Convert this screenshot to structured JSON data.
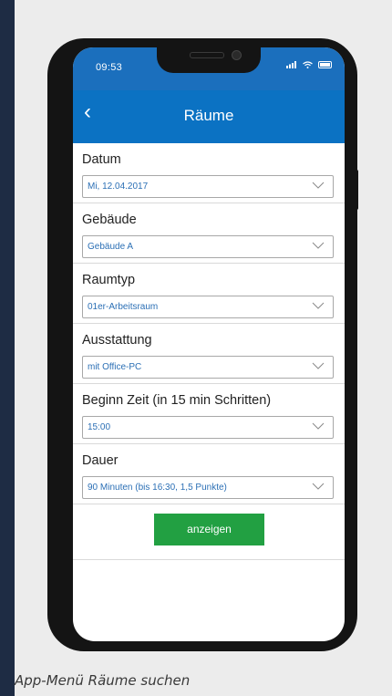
{
  "status_bar": {
    "time": "09:53",
    "signal_icon": "signal-bars-icon",
    "wifi_icon": "wifi-icon",
    "battery_icon": "battery-icon"
  },
  "nav": {
    "back_icon": "chevron-left-icon",
    "back_glyph": "‹",
    "title": "Räume",
    "color": "#0b72c3"
  },
  "form": {
    "fields": [
      {
        "label": "Datum",
        "value": "Mi, 12.04.2017"
      },
      {
        "label": "Gebäude",
        "value": "Gebäude A"
      },
      {
        "label": "Raumtyp",
        "value": "01er-Arbeitsraum"
      },
      {
        "label": "Ausstattung",
        "value": "mit Office-PC"
      },
      {
        "label": "Beginn Zeit (in 15 min Schritten)",
        "value": "15:00"
      },
      {
        "label": "Dauer",
        "value": "90 Minuten (bis 16:30, 1,5 Punkte)"
      }
    ],
    "submit_label": "anzeigen",
    "submit_color": "#22a042"
  },
  "caption": "App-Menü Räume suchen"
}
